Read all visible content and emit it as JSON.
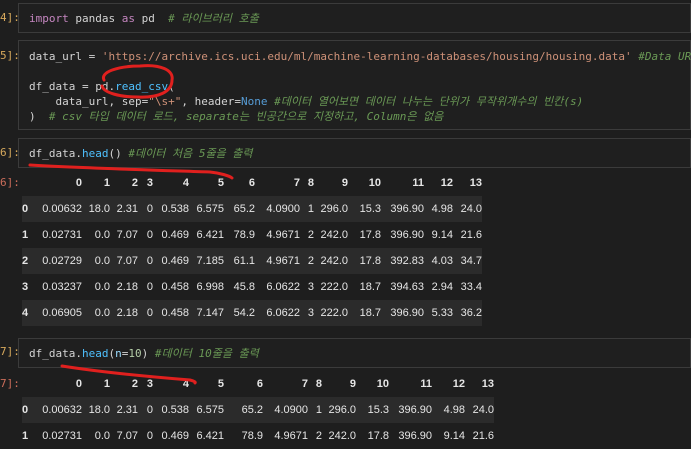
{
  "cells": [
    {
      "prompt": "4]:",
      "code": {
        "kw1": "import",
        "mod": " pandas ",
        "kw2": "as",
        "alias": " pd  ",
        "comment": "# 라이브러리 호출"
      }
    },
    {
      "prompt": "5]:",
      "line1": {
        "var": "data_url",
        "eq": " = ",
        "str": "'https://archive.ics.uci.edu/ml/machine-learning-databases/housing/housing.data'",
        "comment": " #Data URL"
      },
      "line2": {
        "var": "df_data",
        "eq": " = ",
        "obj": "pd.",
        "fn": "read_csv",
        "paren": "("
      },
      "line3": {
        "indent": "    ",
        "arg": "data_url",
        "sep_kw": ", sep=",
        "sep_val": "\"\\s+\"",
        "hdr_kw": ", header=",
        "hdr_val": "None",
        "comment": " #데이터 열어보면 데이터 나누는 단위가 무작위개수의 빈칸(s)"
      },
      "line4": {
        "paren": ")",
        "comment": "  # csv 타입 데이터 로드, separate는 빈공간으로 지정하고, Column은 없음"
      }
    },
    {
      "prompt": "6]:",
      "code": {
        "obj": "df_data.",
        "fn": "head",
        "args": "()",
        "comment": " #데이터 처음 5줄을 출력"
      }
    },
    {
      "prompt": "7]:",
      "code": {
        "obj": "df_data.",
        "fn": "head",
        "open": "(",
        "param": "n",
        "eq": "=",
        "num": "10",
        "close": ")",
        "comment": " #데이터 10줄을 출력"
      }
    }
  ],
  "output_prompts": [
    "6]:",
    "7]:"
  ],
  "table1": {
    "columns": [
      "0",
      "1",
      "2",
      "3",
      "4",
      "5",
      "6",
      "7",
      "8",
      "9",
      "10",
      "11",
      "12",
      "13"
    ],
    "rows": [
      {
        "index": "0",
        "values": [
          "0.00632",
          "18.0",
          "2.31",
          "0",
          "0.538",
          "6.575",
          "65.2",
          "4.0900",
          "1",
          "296.0",
          "15.3",
          "396.90",
          "4.98",
          "24.0"
        ]
      },
      {
        "index": "1",
        "values": [
          "0.02731",
          "0.0",
          "7.07",
          "0",
          "0.469",
          "6.421",
          "78.9",
          "4.9671",
          "2",
          "242.0",
          "17.8",
          "396.90",
          "9.14",
          "21.6"
        ]
      },
      {
        "index": "2",
        "values": [
          "0.02729",
          "0.0",
          "7.07",
          "0",
          "0.469",
          "7.185",
          "61.1",
          "4.9671",
          "2",
          "242.0",
          "17.8",
          "392.83",
          "4.03",
          "34.7"
        ]
      },
      {
        "index": "3",
        "values": [
          "0.03237",
          "0.0",
          "2.18",
          "0",
          "0.458",
          "6.998",
          "45.8",
          "6.0622",
          "3",
          "222.0",
          "18.7",
          "394.63",
          "2.94",
          "33.4"
        ]
      },
      {
        "index": "4",
        "values": [
          "0.06905",
          "0.0",
          "2.18",
          "0",
          "0.458",
          "7.147",
          "54.2",
          "6.0622",
          "3",
          "222.0",
          "18.7",
          "396.90",
          "5.33",
          "36.2"
        ]
      }
    ]
  },
  "table2": {
    "columns": [
      "0",
      "1",
      "2",
      "3",
      "4",
      "5",
      "6",
      "7",
      "8",
      "9",
      "10",
      "11",
      "12",
      "13"
    ],
    "rows": [
      {
        "index": "0",
        "values": [
          "0.00632",
          "18.0",
          "2.31",
          "0",
          "0.538",
          "6.575",
          "65.2",
          "4.0900",
          "1",
          "296.0",
          "15.3",
          "396.90",
          "4.98",
          "24.0"
        ]
      },
      {
        "index": "1",
        "values": [
          "0.02731",
          "0.0",
          "7.07",
          "0",
          "0.469",
          "6.421",
          "78.9",
          "4.9671",
          "2",
          "242.0",
          "17.8",
          "396.90",
          "9.14",
          "21.6"
        ]
      }
    ]
  }
}
